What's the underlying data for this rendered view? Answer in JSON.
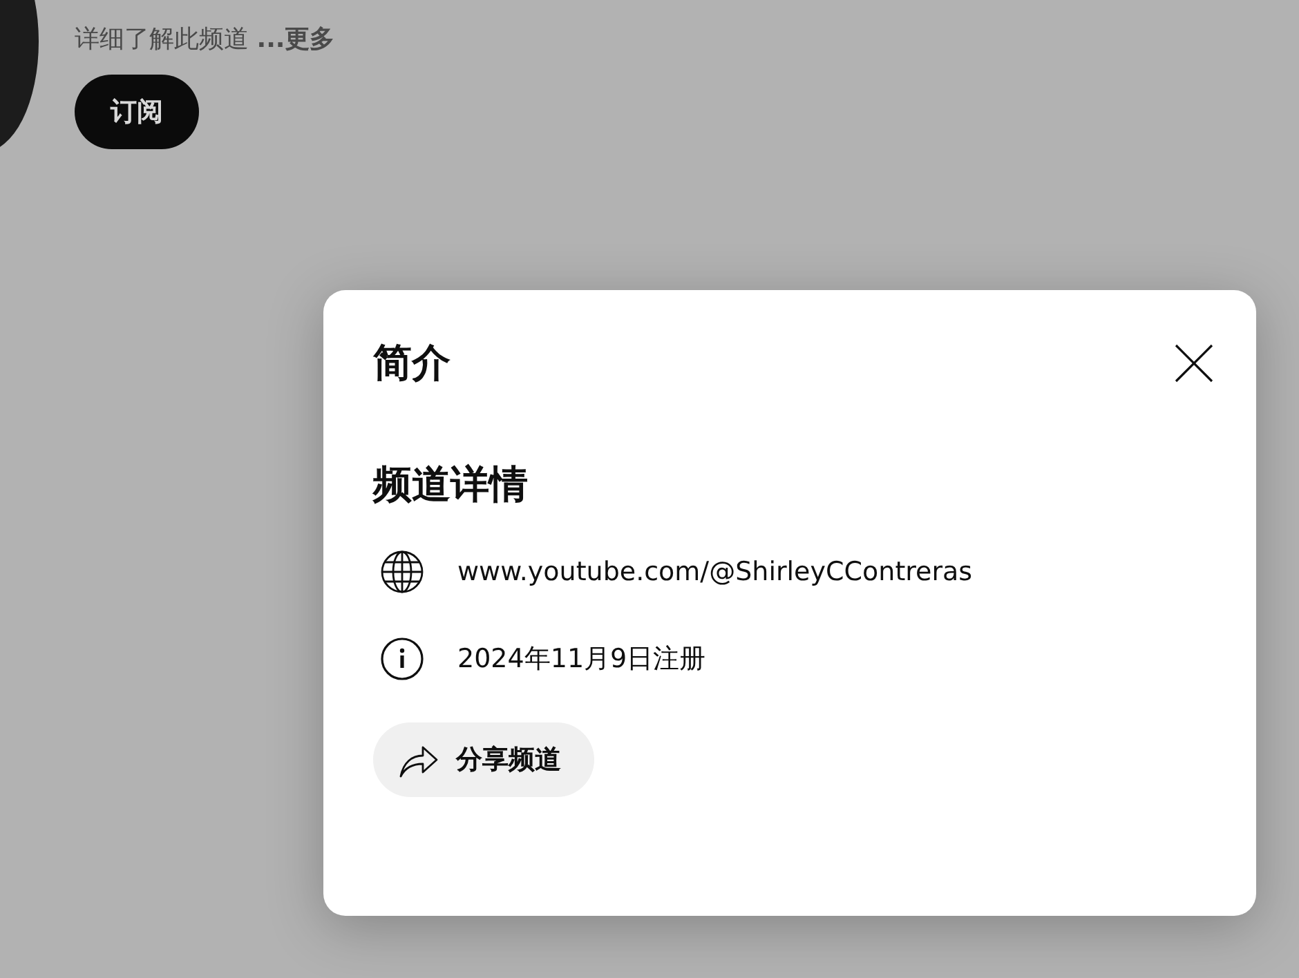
{
  "channel": {
    "description": "详细了解此频道 **...更多**",
    "subscribe_button": "订阅"
  },
  "dialog": {
    "title": "简介",
    "section_title": "频道详情",
    "details": [
      {
        "kind": "link",
        "text": "www.youtube.com/@ShirleyCContreras"
      },
      {
        "kind": "info",
        "text": "2024年11月9日注册"
      }
    ],
    "share_button": "分享频道"
  }
}
